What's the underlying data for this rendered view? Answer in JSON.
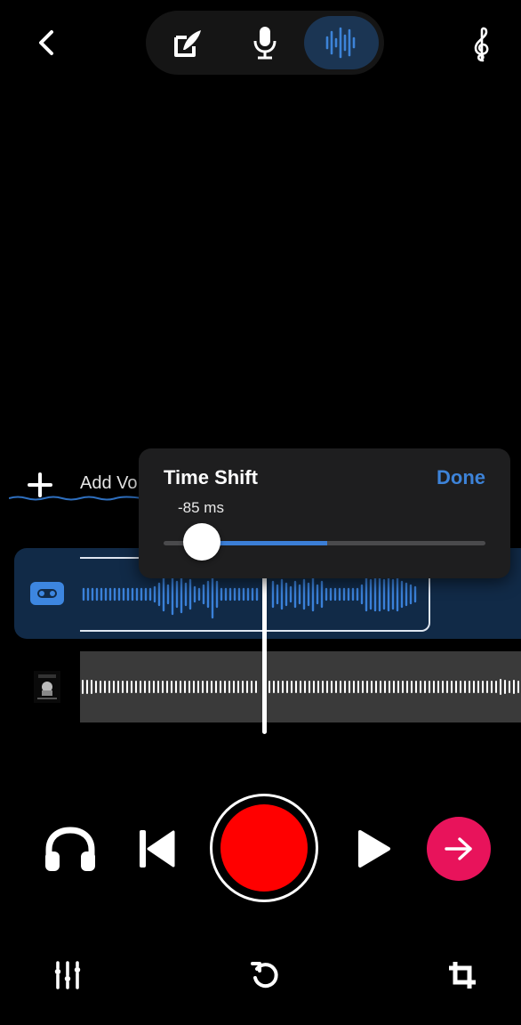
{
  "header": {
    "back_icon": "chevron-left-icon",
    "modes": [
      {
        "name": "lyrics",
        "icon": "edit-pen-icon",
        "active": false
      },
      {
        "name": "record",
        "icon": "microphone-icon",
        "active": false
      },
      {
        "name": "waveform",
        "icon": "waveform-icon",
        "active": true
      }
    ],
    "clef_icon": "treble-clef-icon"
  },
  "tracks_area": {
    "add_label": "Add Vo"
  },
  "time_shift": {
    "title": "Time Shift",
    "done_label": "Done",
    "value_text": "-85 ms"
  },
  "transport": {
    "headphones_icon": "headphones-icon",
    "skip_back_icon": "skip-back-icon",
    "record_icon": "record-icon",
    "play_icon": "play-icon",
    "next_icon": "arrow-right-icon"
  },
  "bottom_bar": {
    "mixer_icon": "sliders-icon",
    "undo_icon": "undo-icon",
    "crop_icon": "crop-icon"
  },
  "colors": {
    "accent": "#3d83d8",
    "record": "#ff0000",
    "next": "#e8135b",
    "track_bg": "#112a47"
  }
}
